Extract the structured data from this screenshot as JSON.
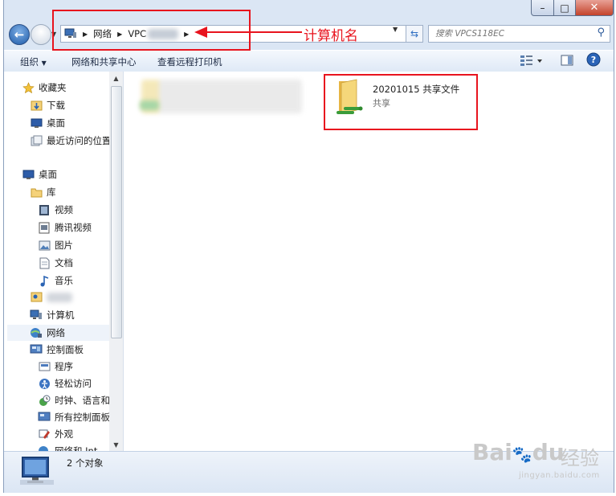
{
  "window": {
    "controls": {
      "minimize": "–",
      "maximize": "□",
      "close": "✕"
    }
  },
  "navigation": {
    "breadcrumb": [
      "网络",
      "VPC"
    ],
    "search_placeholder": "搜索 VPCS118EC"
  },
  "toolbar": {
    "organize": "组织",
    "network_center": "网络和共享中心",
    "printers": "查看远程打印机"
  },
  "sidebar": {
    "favorites": {
      "label": "收藏夹",
      "items": [
        "下载",
        "桌面",
        "最近访问的位置"
      ]
    },
    "desktop": "桌面",
    "libraries": {
      "label": "库",
      "items": [
        "视频",
        "腾讯视频",
        "图片",
        "文档",
        "音乐"
      ]
    },
    "computer": "计算机",
    "network": "网络",
    "control_panel": {
      "label": "控制面板",
      "items": [
        "程序",
        "轻松访问",
        "时钟、语言和[",
        "所有控制面板¥",
        "外观",
        "网络和 Int"
      ]
    }
  },
  "content": {
    "shared_folder": {
      "name": "20201015 共享文件",
      "subtitle": "共享"
    }
  },
  "status": {
    "count": "2 个对象"
  },
  "annotation": {
    "label": "计算机名",
    "color": "#e8141e"
  },
  "watermark": {
    "brand": "Bai",
    "brand2": "du",
    "cn": "经验",
    "url": "jingyan.baidu.com"
  },
  "colors": {
    "frame": "#dbe6f4",
    "accent": "#2f6ec2",
    "annotation": "#e8141e"
  }
}
